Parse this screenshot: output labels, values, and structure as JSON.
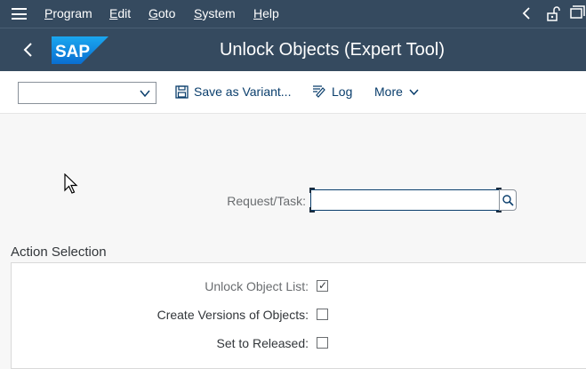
{
  "menubar": {
    "items": [
      {
        "label_u": "P",
        "label_rest": "rogram"
      },
      {
        "label_u": "E",
        "label_rest": "dit"
      },
      {
        "label_u": "G",
        "label_rest": "oto"
      },
      {
        "label_u": "S",
        "label_rest": "ystem"
      },
      {
        "label_u": "H",
        "label_rest": "elp"
      }
    ]
  },
  "titlebar": {
    "logo_text": "SAP",
    "title": "Unlock Objects (Expert Tool)"
  },
  "toolbar": {
    "variant_value": "",
    "save_variant_label": "Save as Variant...",
    "log_label": "Log",
    "more_label": "More"
  },
  "form": {
    "request_task_label": "Request/Task:",
    "request_task_value": ""
  },
  "action_selection": {
    "title": "Action Selection",
    "options": [
      {
        "label": "Unlock Object List:",
        "checked": true
      },
      {
        "label": "Create Versions of Objects:",
        "checked": false
      },
      {
        "label": "Set to Released:",
        "checked": false
      }
    ]
  },
  "colors": {
    "shell_bar": "#354a5f",
    "link_blue": "#0a3e6c",
    "logo_blue": "#0a6ed1"
  }
}
